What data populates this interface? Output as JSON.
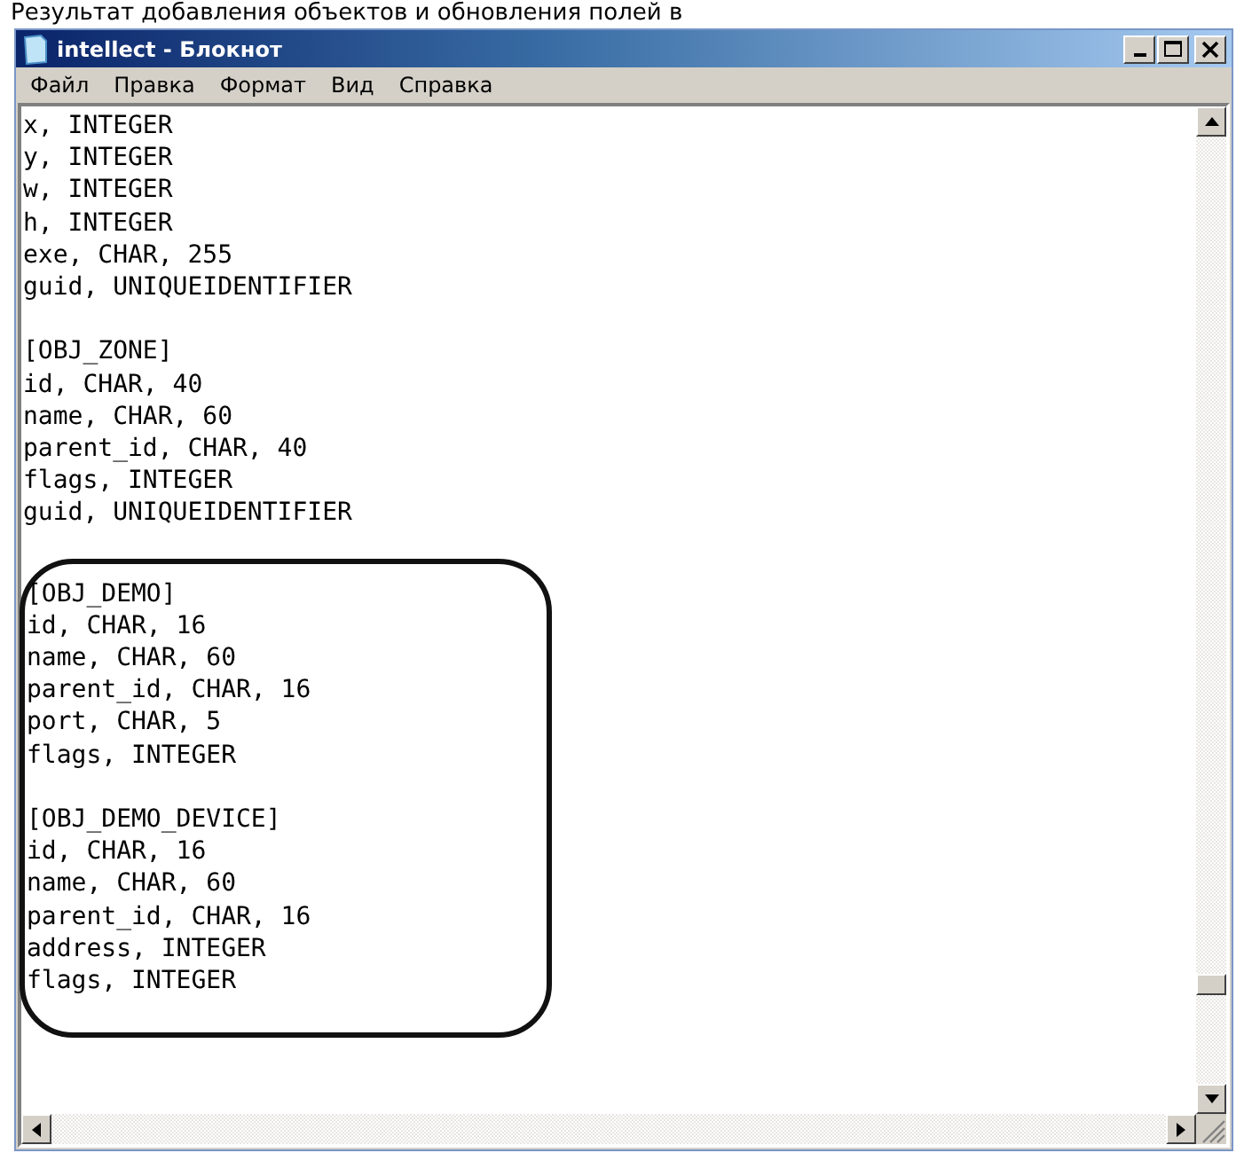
{
  "caption": "Результат добавления объектов и обновления полей в",
  "window": {
    "title": "intellect - Блокнот"
  },
  "window_buttons": [
    {
      "kind": "minimize"
    },
    {
      "kind": "maximize"
    },
    {
      "kind": "close"
    }
  ],
  "menu": [
    "Файл",
    "Правка",
    "Формат",
    "Вид",
    "Справка"
  ],
  "text_groups": [
    {
      "circled": false,
      "paragraphs": [
        [
          "x, INTEGER",
          "y, INTEGER",
          "w, INTEGER",
          "h, INTEGER",
          "exe, CHAR, 255",
          "guid, UNIQUEIDENTIFIER"
        ],
        [
          "[OBJ_ZONE]",
          "id, CHAR, 40",
          "name, CHAR, 60",
          "parent_id, CHAR, 40",
          "flags, INTEGER",
          "guid, UNIQUEIDENTIFIER"
        ]
      ]
    },
    {
      "circled": true,
      "paragraphs": [
        [
          "[OBJ_DEMO]",
          "id, CHAR, 16",
          "name, CHAR, 60",
          "parent_id, CHAR, 16",
          "port, CHAR, 5",
          "flags, INTEGER"
        ],
        [
          "[OBJ_DEMO_DEVICE]",
          "id, CHAR, 16",
          "name, CHAR, 60",
          "parent_id, CHAR, 16",
          "address, INTEGER",
          "flags, INTEGER"
        ]
      ]
    }
  ]
}
